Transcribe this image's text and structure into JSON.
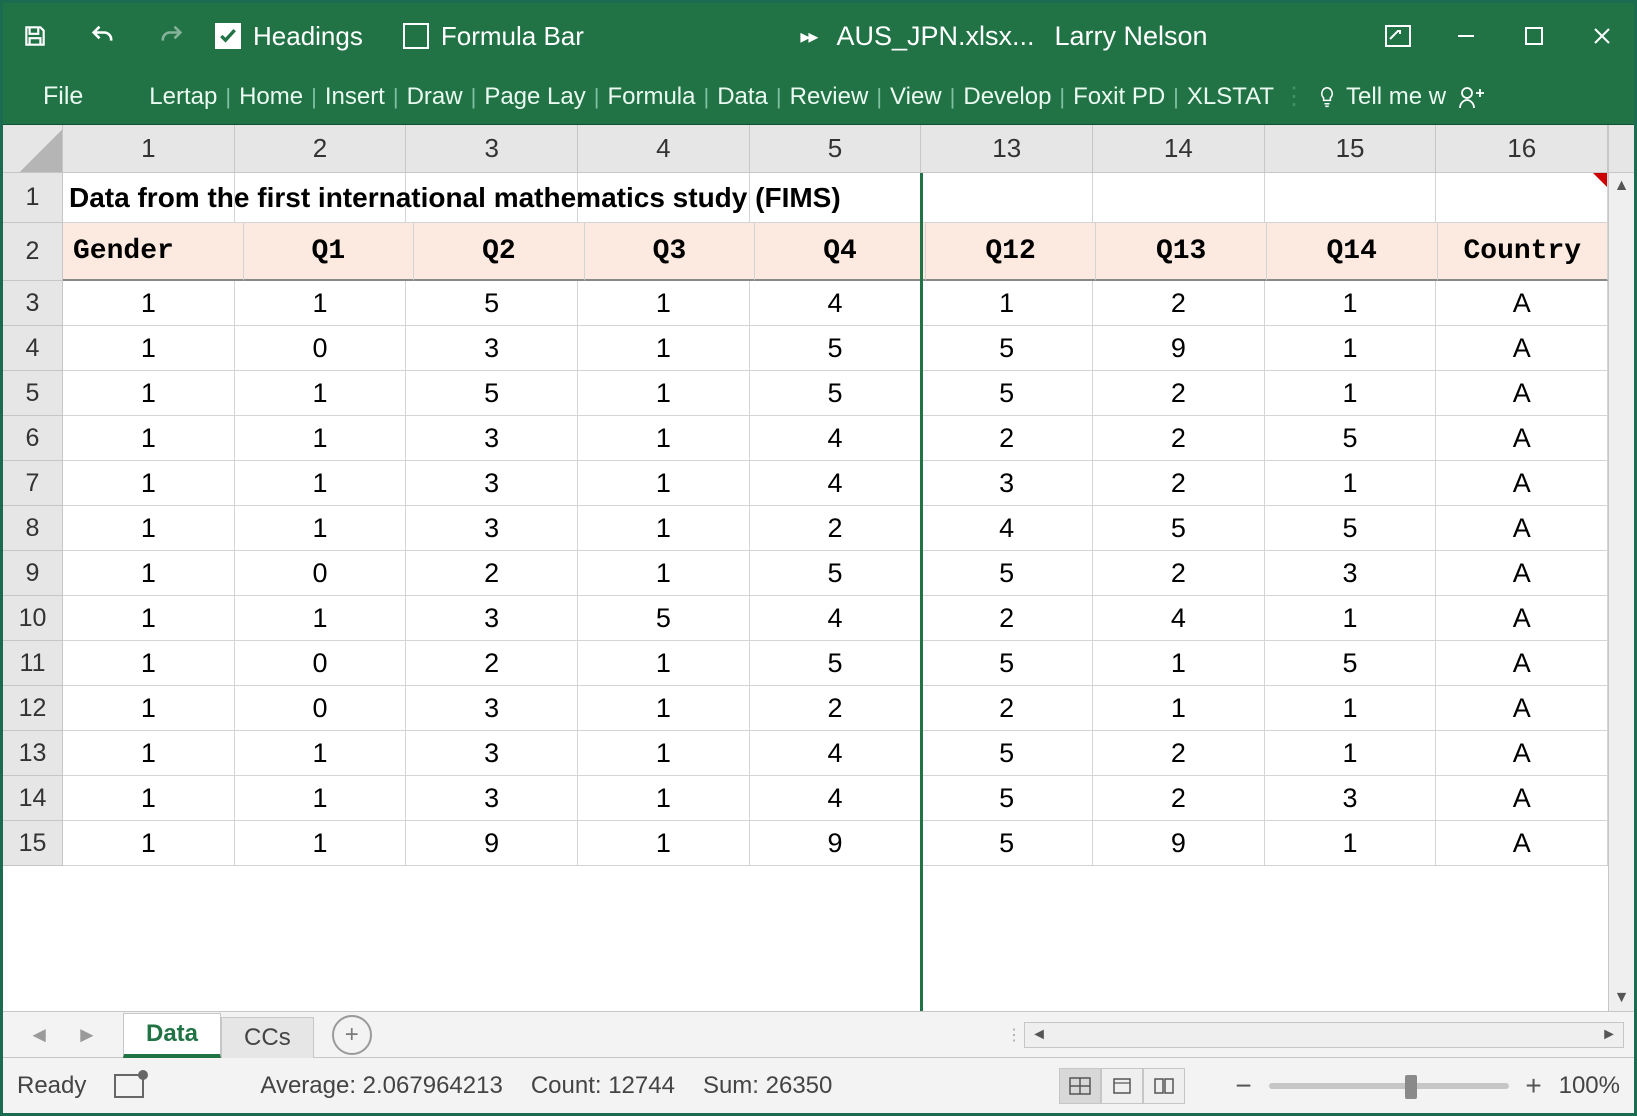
{
  "titlebar": {
    "headings_label": "Headings",
    "formula_bar_label": "Formula Bar",
    "filename": "AUS_JPN.xlsx...",
    "user": "Larry Nelson"
  },
  "ribbon": {
    "file": "File",
    "tabs": [
      "Lertap",
      "Home",
      "Insert",
      "Draw",
      "Page Lay",
      "Formula",
      "Data",
      "Review",
      "View",
      "Develop",
      "Foxit PD",
      "XLSTAT"
    ],
    "tell_me": "Tell me w"
  },
  "columns": [
    "1",
    "2",
    "3",
    "4",
    "5",
    "13",
    "14",
    "15",
    "16"
  ],
  "row_numbers": [
    "1",
    "2",
    "3",
    "4",
    "5",
    "6",
    "7",
    "8",
    "9",
    "10",
    "11",
    "12",
    "13",
    "14",
    "15"
  ],
  "title_row": "Data from the first international mathematics study (FIMS)",
  "header_row": [
    "Gender",
    "Q1",
    "Q2",
    "Q3",
    "Q4",
    "Q12",
    "Q13",
    "Q14",
    "Country"
  ],
  "data_rows": [
    [
      "1",
      "1",
      "5",
      "1",
      "4",
      "1",
      "2",
      "1",
      "A"
    ],
    [
      "1",
      "0",
      "3",
      "1",
      "5",
      "5",
      "9",
      "1",
      "A"
    ],
    [
      "1",
      "1",
      "5",
      "1",
      "5",
      "5",
      "2",
      "1",
      "A"
    ],
    [
      "1",
      "1",
      "3",
      "1",
      "4",
      "2",
      "2",
      "5",
      "A"
    ],
    [
      "1",
      "1",
      "3",
      "1",
      "4",
      "3",
      "2",
      "1",
      "A"
    ],
    [
      "1",
      "1",
      "3",
      "1",
      "2",
      "4",
      "5",
      "5",
      "A"
    ],
    [
      "1",
      "0",
      "2",
      "1",
      "5",
      "5",
      "2",
      "3",
      "A"
    ],
    [
      "1",
      "1",
      "3",
      "5",
      "4",
      "2",
      "4",
      "1",
      "A"
    ],
    [
      "1",
      "0",
      "2",
      "1",
      "5",
      "5",
      "1",
      "5",
      "A"
    ],
    [
      "1",
      "0",
      "3",
      "1",
      "2",
      "2",
      "1",
      "1",
      "A"
    ],
    [
      "1",
      "1",
      "3",
      "1",
      "4",
      "5",
      "2",
      "1",
      "A"
    ],
    [
      "1",
      "1",
      "3",
      "1",
      "4",
      "5",
      "2",
      "3",
      "A"
    ],
    [
      "1",
      "1",
      "9",
      "1",
      "9",
      "5",
      "9",
      "1",
      "A"
    ]
  ],
  "sheets": {
    "active": "Data",
    "others": [
      "CCs"
    ]
  },
  "status": {
    "ready": "Ready",
    "average": "Average: 2.067964213",
    "count": "Count: 12744",
    "sum": "Sum: 26350",
    "zoom": "100%"
  }
}
